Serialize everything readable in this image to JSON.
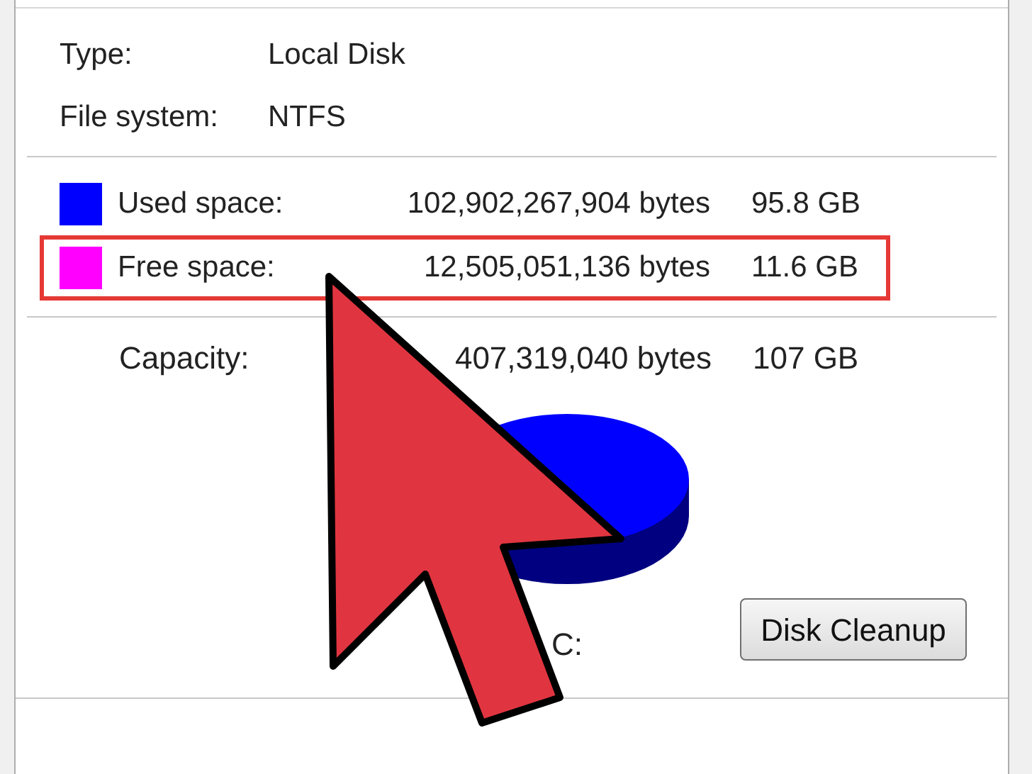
{
  "details": [
    {
      "label": "Type:",
      "value": "Local Disk"
    },
    {
      "label": "File system:",
      "value": "NTFS"
    }
  ],
  "space": [
    {
      "label": "Used space:",
      "bytes": "102,902,267,904 bytes",
      "size": "95.8 GB",
      "color": "#0000ff",
      "highlighted": false
    },
    {
      "label": "Free space:",
      "bytes": "12,505,051,136 bytes",
      "size": "11.6 GB",
      "color": "#ff00ff",
      "highlighted": true
    }
  ],
  "capacity": {
    "label": "Capacity:",
    "bytes": "407,319,040 bytes",
    "size": "107 GB"
  },
  "drive": {
    "label": "C:"
  },
  "button": {
    "label": "Disk Cleanup"
  }
}
